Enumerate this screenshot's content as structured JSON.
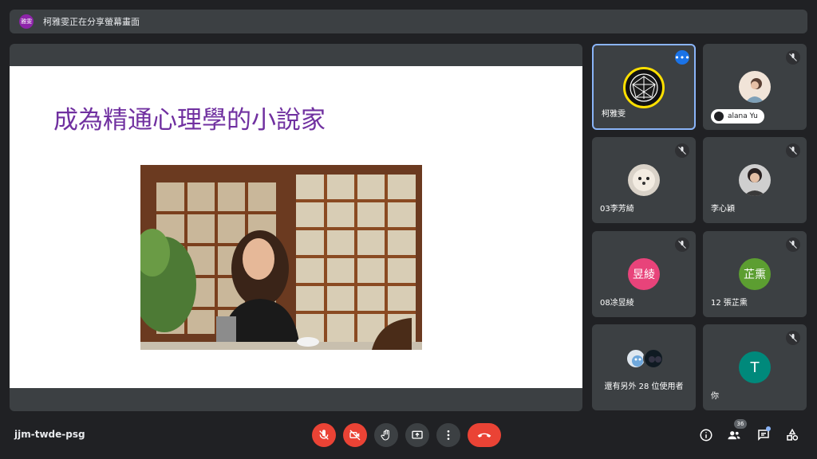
{
  "banner": {
    "avatar_label": "雅雯",
    "text": "柯雅雯正在分享螢幕畫面"
  },
  "slide": {
    "title": "成為精通心理學的小說家"
  },
  "participants": [
    {
      "name": "柯雅雯",
      "avatar_type": "logo",
      "active": true
    },
    {
      "name": "alana Yu",
      "avatar_type": "photo"
    },
    {
      "name": "03李芳綺",
      "avatar_type": "photo"
    },
    {
      "name": "李心穎",
      "avatar_type": "photo"
    },
    {
      "name": "08凃昱綾",
      "avatar_type": "initials",
      "initials": "昱綾",
      "color": "#e8437a"
    },
    {
      "name": "12 張芷熏",
      "avatar_type": "initials",
      "initials": "芷熏",
      "color": "#5c9e31"
    },
    {
      "name": "還有另外 28 位使用者",
      "avatar_type": "group"
    },
    {
      "name": "你",
      "avatar_type": "initials",
      "initials": "T",
      "color": "#00897b"
    }
  ],
  "bottom": {
    "meeting_code": "jjm-twde-psg",
    "participant_count": "36"
  },
  "colors": {
    "danger": "#ea4335",
    "accent": "#1a73e8",
    "surface": "#3c4043"
  }
}
